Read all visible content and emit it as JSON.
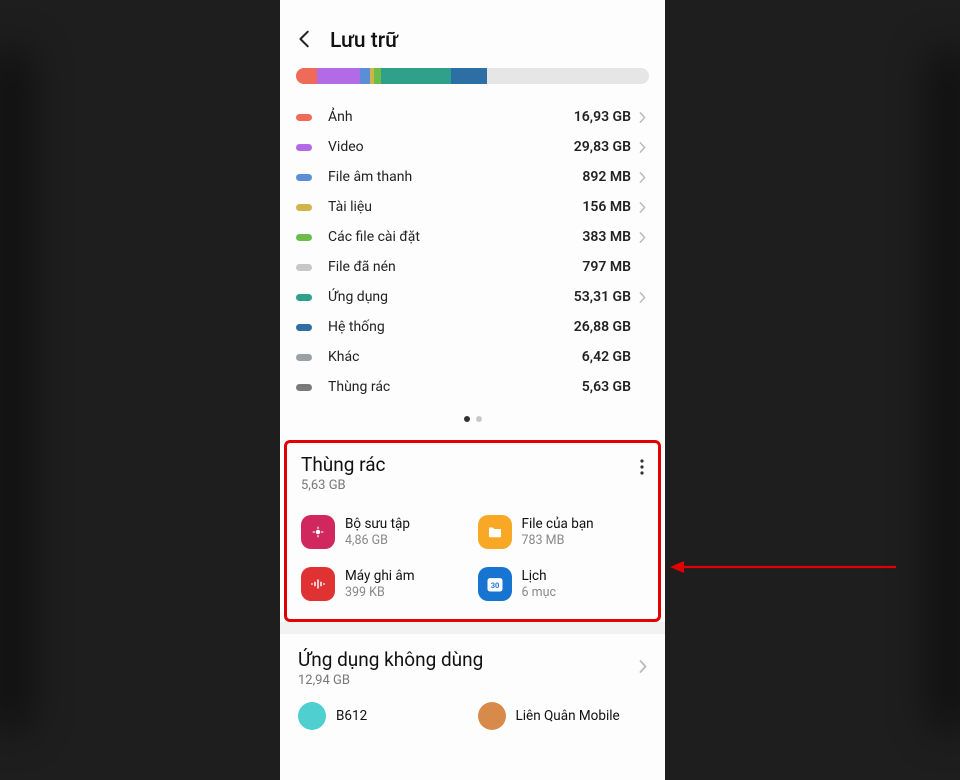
{
  "header": {
    "title": "Lưu trữ"
  },
  "storage_bar": [
    {
      "color": "#ee6b5a",
      "pct": 6
    },
    {
      "color": "#b26ae6",
      "pct": 12
    },
    {
      "color": "#5a8fd8",
      "pct": 3
    },
    {
      "color": "#d0b34a",
      "pct": 1
    },
    {
      "color": "#6fbc4c",
      "pct": 2
    },
    {
      "color": "#2fa08a",
      "pct": 20
    },
    {
      "color": "#2d6ea5",
      "pct": 10
    }
  ],
  "categories": [
    {
      "label": "Ảnh",
      "size": "16,93 GB",
      "color": "#ee6b5a",
      "chevron": true
    },
    {
      "label": "Video",
      "size": "29,83 GB",
      "color": "#b26ae6",
      "chevron": true
    },
    {
      "label": "File âm thanh",
      "size": "892 MB",
      "color": "#5a8fd8",
      "chevron": true
    },
    {
      "label": "Tài liệu",
      "size": "156 MB",
      "color": "#d0b34a",
      "chevron": true
    },
    {
      "label": "Các file cài đặt",
      "size": "383 MB",
      "color": "#6fbc4c",
      "chevron": true
    },
    {
      "label": "File đã nén",
      "size": "797 MB",
      "color": "#c7c7c7",
      "chevron": false
    },
    {
      "label": "Ứng dụng",
      "size": "53,31 GB",
      "color": "#2fa08a",
      "chevron": true
    },
    {
      "label": "Hệ thống",
      "size": "26,88 GB",
      "color": "#2d6ea5",
      "chevron": false
    },
    {
      "label": "Khác",
      "size": "6,42 GB",
      "color": "#9aa0a6",
      "chevron": false
    },
    {
      "label": "Thùng rác",
      "size": "5,63 GB",
      "color": "#7a7a7a",
      "chevron": false
    }
  ],
  "trash": {
    "title": "Thùng rác",
    "size": "5,63 GB",
    "items": [
      {
        "label": "Bộ sưu tập",
        "sub": "4,86 GB",
        "icon": "gallery"
      },
      {
        "label": "File của bạn",
        "sub": "783 MB",
        "icon": "files"
      },
      {
        "label": "Máy ghi âm",
        "sub": "399 KB",
        "icon": "voice"
      },
      {
        "label": "Lịch",
        "sub": "6 mục",
        "icon": "cal"
      }
    ]
  },
  "unused": {
    "title": "Ứng dụng không dùng",
    "size": "12,94 GB",
    "apps": [
      {
        "name": "B612"
      },
      {
        "name": "Liên Quân Mobile"
      }
    ]
  }
}
